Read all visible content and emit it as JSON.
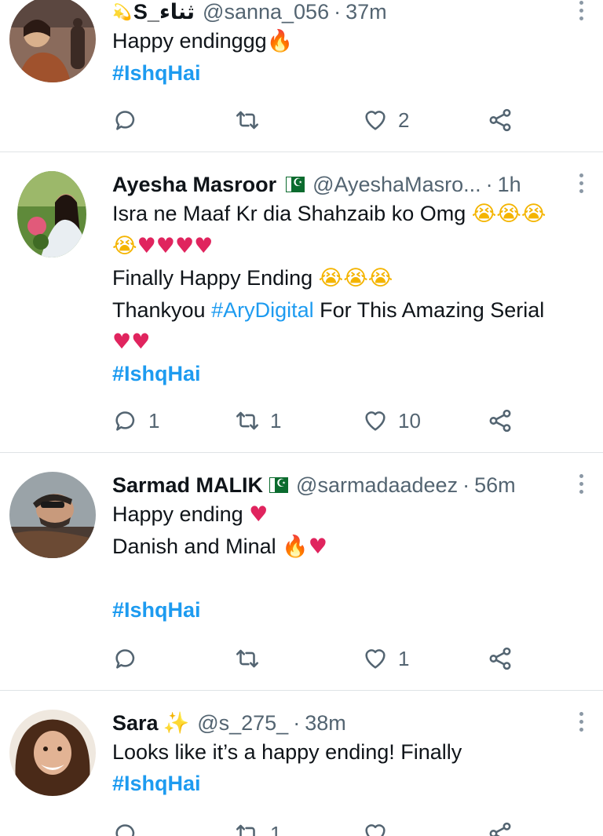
{
  "tweets": [
    {
      "name": "S_ثناء",
      "name_prefix_emoji": "💫",
      "handle": "@sanna_056",
      "separator": "·",
      "time": "37m",
      "lines": [
        [
          {
            "t": "text",
            "v": "Happy endinggg"
          },
          {
            "t": "emoji",
            "v": "🔥",
            "k": "fire"
          }
        ],
        [
          {
            "t": "hashtag-bold",
            "v": "#IshqHai"
          }
        ]
      ],
      "actions": {
        "reply": "",
        "retweet": "",
        "like": "2",
        "share": ""
      }
    },
    {
      "name": "Ayesha Masroor",
      "flag": "pakistan-flag",
      "handle": "@AyeshaMasro...",
      "separator": "·",
      "time": "1h",
      "lines": [
        [
          {
            "t": "text",
            "v": "Isra ne Maaf Kr dia Shahzaib ko Omg "
          },
          {
            "t": "emoji",
            "v": "😭😭😭",
            "k": "cry"
          }
        ],
        [
          {
            "t": "emoji",
            "v": "😭",
            "k": "cry"
          },
          {
            "t": "emoji",
            "v": "♥♥♥♥",
            "k": "heart"
          }
        ],
        [
          {
            "t": "text",
            "v": "Finally Happy Ending "
          },
          {
            "t": "emoji",
            "v": "😭😭😭",
            "k": "cry"
          }
        ],
        [
          {
            "t": "text",
            "v": "Thankyou "
          },
          {
            "t": "hashtag",
            "v": "#AryDigital"
          },
          {
            "t": "text",
            "v": " For This Amazing Serial"
          }
        ],
        [
          {
            "t": "emoji",
            "v": "♥♥",
            "k": "heart"
          }
        ],
        [
          {
            "t": "hashtag-bold",
            "v": "#IshqHai"
          }
        ]
      ],
      "actions": {
        "reply": "1",
        "retweet": "1",
        "like": "10",
        "share": ""
      }
    },
    {
      "name": "Sarmad MALIK",
      "flag": "pakistan-flag",
      "handle": "@sarmadaadeez",
      "separator": "·",
      "time": "56m",
      "lines": [
        [
          {
            "t": "text",
            "v": "Happy ending "
          },
          {
            "t": "emoji",
            "v": "♥",
            "k": "heart"
          }
        ],
        [
          {
            "t": "text",
            "v": "Danish and Minal "
          },
          {
            "t": "emoji",
            "v": "🔥",
            "k": "fire"
          },
          {
            "t": "emoji",
            "v": "♥",
            "k": "heart"
          }
        ],
        [
          {
            "t": "text",
            "v": ""
          }
        ],
        [
          {
            "t": "hashtag-bold",
            "v": "#IshqHai"
          }
        ]
      ],
      "actions": {
        "reply": "",
        "retweet": "",
        "like": "1",
        "share": ""
      }
    },
    {
      "name": "Sara",
      "name_suffix_emoji": "✨",
      "handle": "@s_275_",
      "separator": "·",
      "time": "38m",
      "lines": [
        [
          {
            "t": "text",
            "v": "Looks like it’s a happy ending! Finally"
          }
        ],
        [
          {
            "t": "hashtag-bold",
            "v": "#IshqHai"
          }
        ]
      ],
      "actions": {
        "reply": "",
        "retweet": "1",
        "like": "",
        "share": ""
      }
    }
  ],
  "icons": {
    "reply": "reply-icon",
    "retweet": "retweet-icon",
    "like": "like-icon",
    "share": "share-icon",
    "more": "more-options-icon"
  },
  "colors": {
    "hashtag": "#1d9bf0",
    "secondary_text": "#536471",
    "divider": "#dfe3e6",
    "heart": "#e0245e"
  }
}
